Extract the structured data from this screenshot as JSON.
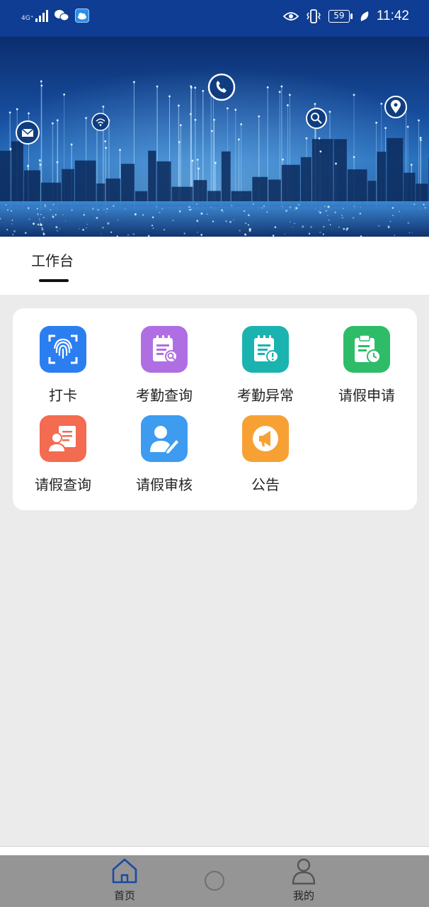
{
  "status_bar": {
    "network": "4G⁺",
    "battery": "59",
    "time": "11:42",
    "icons": [
      "signal-icon",
      "wechat-icon",
      "weather-app-icon",
      "eye-icon",
      "vibrate-icon",
      "battery-icon",
      "leaf-icon"
    ]
  },
  "banner": {
    "floating_icons": [
      "mail-icon",
      "wifi-icon",
      "phone-icon",
      "search-icon",
      "location-pin-icon"
    ],
    "colors": {
      "deep": "#0b2d6e",
      "mid": "#1f67b8",
      "light": "#8fd3ff"
    }
  },
  "tabs": [
    {
      "label": "工作台",
      "active": true
    }
  ],
  "grid": {
    "items": [
      {
        "label": "打卡",
        "icon": "fingerprint-icon",
        "color": "#2b7ef0"
      },
      {
        "label": "考勤查询",
        "icon": "attendance-search-icon",
        "color": "#b06ee3"
      },
      {
        "label": "考勤异常",
        "icon": "attendance-exception-icon",
        "color": "#1bb3b0"
      },
      {
        "label": "请假申请",
        "icon": "leave-apply-icon",
        "color": "#2ebc69"
      },
      {
        "label": "请假查询",
        "icon": "leave-query-icon",
        "color": "#f36b50"
      },
      {
        "label": "请假审核",
        "icon": "leave-review-icon",
        "color": "#3d9bf0"
      },
      {
        "label": "公告",
        "icon": "announcement-icon",
        "color": "#f7a134"
      }
    ]
  },
  "bottom_nav": {
    "items": [
      {
        "label": "首页",
        "icon": "home-icon",
        "active": true
      },
      {
        "label": "我的",
        "icon": "user-icon",
        "active": false
      }
    ],
    "system_home_icon": "home-button-icon"
  }
}
